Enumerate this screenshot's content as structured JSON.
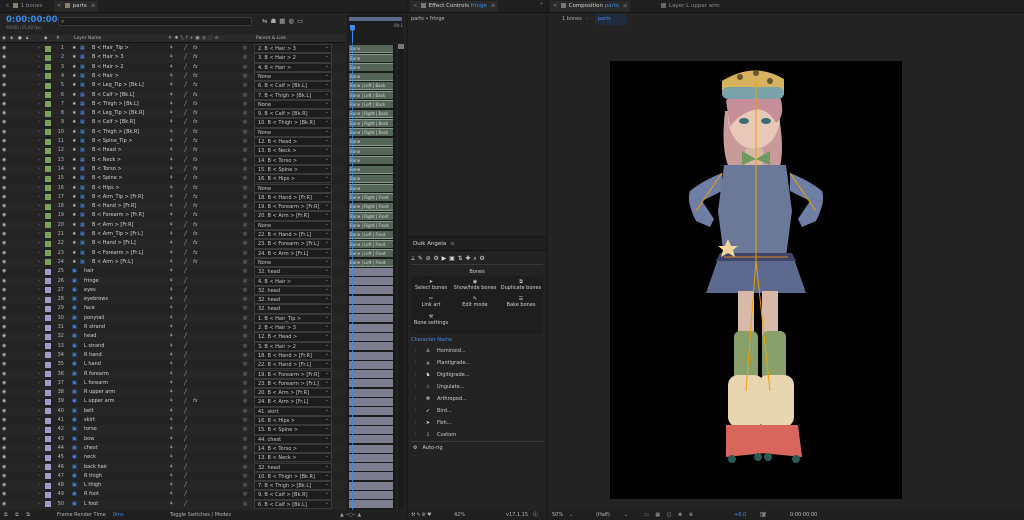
{
  "timeline": {
    "tabs": [
      {
        "label": "1 bones"
      },
      {
        "label": "parts"
      }
    ],
    "timecode": "0:00:00:00",
    "frame_info": "00000 (25.00 fps)",
    "search_placeholder": "",
    "col_layer_name": "Layer Name",
    "col_parent": "Parent & Link",
    "ruler_end": "00:1",
    "footer_render": "Frame Render Time",
    "footer_render_val": "0ms",
    "footer_toggle": "Toggle Switches / Modes",
    "layers": [
      {
        "n": "1",
        "name": "B < Hair_Tip >",
        "parent": "2. B < Hair > 3",
        "g": "b",
        "c": "#7ea05f",
        "bone": "Bone"
      },
      {
        "n": "2",
        "name": "B < Hair > 3",
        "parent": "3. B < Hair > 2",
        "g": "b",
        "c": "#7ea05f",
        "bone": "Bone"
      },
      {
        "n": "3",
        "name": "B < Hair > 2",
        "parent": "4. B < Hair >",
        "g": "b",
        "c": "#7ea05f",
        "bone": "Bone"
      },
      {
        "n": "4",
        "name": "B < Hair >",
        "parent": "None",
        "g": "b",
        "c": "#7ea05f",
        "bone": "Bone"
      },
      {
        "n": "5",
        "name": "B < Leg_Tip > [Bk.L]",
        "parent": "6. B < Calf > [Bk.L]",
        "g": "b",
        "c": "#7ea05f",
        "bone": "Bone | Left | Back"
      },
      {
        "n": "6",
        "name": "B < Calf > [Bk.L]",
        "parent": "7. B < Thigh > [Bk.L]",
        "g": "b",
        "c": "#7ea05f",
        "bone": "Bone | Left | Back"
      },
      {
        "n": "7",
        "name": "B < Thigh > [Bk.L]",
        "parent": "None",
        "g": "b",
        "c": "#7ea05f",
        "bone": "Bone | Left | Back"
      },
      {
        "n": "8",
        "name": "B < Leg_Tip > [Bk.R]",
        "parent": "9. B < Calf > [Bk.R]",
        "g": "b",
        "c": "#7ea05f",
        "bone": "Bone | Right | Back"
      },
      {
        "n": "9",
        "name": "B < Calf > [Bk.R]",
        "parent": "10. B < Thigh > [Bk.R]",
        "g": "b",
        "c": "#7ea05f",
        "bone": "Bone | Right | Back"
      },
      {
        "n": "10",
        "name": "B < Thigh > [Bk.R]",
        "parent": "None",
        "g": "b",
        "c": "#7ea05f",
        "bone": "Bone | Right | Back"
      },
      {
        "n": "11",
        "name": "B < Spine_Tip >",
        "parent": "12. B < Head >",
        "g": "b",
        "c": "#7ea05f",
        "bone": "Bone"
      },
      {
        "n": "12",
        "name": "B < Head >",
        "parent": "13. B < Neck >",
        "g": "b",
        "c": "#7ea05f",
        "bone": "Bone"
      },
      {
        "n": "13",
        "name": "B < Neck >",
        "parent": "14. B < Torso >",
        "g": "b",
        "c": "#7ea05f",
        "bone": "Bone"
      },
      {
        "n": "14",
        "name": "B < Torso >",
        "parent": "15. B < Spine >",
        "g": "b",
        "c": "#7ea05f",
        "bone": "Bone"
      },
      {
        "n": "15",
        "name": "B < Spine >",
        "parent": "16. B < Hips >",
        "g": "b",
        "c": "#7ea05f",
        "bone": "Bone"
      },
      {
        "n": "16",
        "name": "B < Hips >",
        "parent": "None",
        "g": "b",
        "c": "#7ea05f",
        "bone": "Bone"
      },
      {
        "n": "17",
        "name": "B < Arm_Tip > [Fr.R]",
        "parent": "18. B < Hand > [Fr.R]",
        "g": "b",
        "c": "#7ea05f",
        "bone": "Bone | Right | Front"
      },
      {
        "n": "18",
        "name": "B < Hand > [Fr.R]",
        "parent": "19. B < Forearm > [Fr.R]",
        "g": "b",
        "c": "#7ea05f",
        "bone": "Bone | Right | Front"
      },
      {
        "n": "19",
        "name": "B < Forearm > [Fr.R]",
        "parent": "20. B < Arm > [Fr.R]",
        "g": "b",
        "c": "#7ea05f",
        "bone": "Bone | Right | Front"
      },
      {
        "n": "20",
        "name": "B < Arm > [Fr.R]",
        "parent": "None",
        "g": "b",
        "c": "#7ea05f",
        "bone": "Bone | Right | Front"
      },
      {
        "n": "21",
        "name": "B < Arm_Tip > [Fr.L]",
        "parent": "22. B < Hand > [Fr.L]",
        "g": "b",
        "c": "#7ea05f",
        "bone": "Bone | Left | Front"
      },
      {
        "n": "22",
        "name": "B < Hand > [Fr.L]",
        "parent": "23. B < Forearm > [Fr.L]",
        "g": "b",
        "c": "#7ea05f",
        "bone": "Bone | Left | Front"
      },
      {
        "n": "23",
        "name": "B < Forearm > [Fr.L]",
        "parent": "24. B < Arm > [Fr.L]",
        "g": "b",
        "c": "#7ea05f",
        "bone": "Bone | Left | Front"
      },
      {
        "n": "24",
        "name": "B < Arm > [Fr.L]",
        "parent": "None",
        "g": "b",
        "c": "#7ea05f",
        "bone": "Bone | Left | Front"
      },
      {
        "n": "25",
        "name": "hair",
        "parent": "32. head",
        "g": "l",
        "c": "#a59ac7",
        "bone": ""
      },
      {
        "n": "26",
        "name": "fringe",
        "parent": "4. B < Hair >",
        "g": "l",
        "c": "#a59ac7",
        "bone": ""
      },
      {
        "n": "27",
        "name": "eyes",
        "parent": "32. head",
        "g": "l",
        "c": "#a59ac7",
        "bone": ""
      },
      {
        "n": "28",
        "name": "eyebrows",
        "parent": "32. head",
        "g": "l",
        "c": "#a59ac7",
        "bone": ""
      },
      {
        "n": "29",
        "name": "face",
        "parent": "32. head",
        "g": "l",
        "c": "#a59ac7",
        "bone": ""
      },
      {
        "n": "30",
        "name": "ponytail",
        "parent": "1. B < Hair_Tip >",
        "g": "l",
        "c": "#a59ac7",
        "bone": ""
      },
      {
        "n": "31",
        "name": "R strand",
        "parent": "2. B < Hair > 3",
        "g": "l",
        "c": "#a59ac7",
        "bone": ""
      },
      {
        "n": "32",
        "name": "head",
        "parent": "12. B < Head >",
        "g": "l",
        "c": "#a59ac7",
        "bone": ""
      },
      {
        "n": "33",
        "name": "L strand",
        "parent": "3. B < Hair > 2",
        "g": "l",
        "c": "#a59ac7",
        "bone": ""
      },
      {
        "n": "34",
        "name": "R hand",
        "parent": "18. B < Hand > [Fr.R]",
        "g": "l",
        "c": "#a59ac7",
        "bone": ""
      },
      {
        "n": "35",
        "name": "L hand",
        "parent": "22. B < Hand > [Fr.L]",
        "g": "l",
        "c": "#a59ac7",
        "bone": ""
      },
      {
        "n": "36",
        "name": "R forearm",
        "parent": "19. B < Forearm > [Fr.R]",
        "g": "l",
        "c": "#a59ac7",
        "bone": ""
      },
      {
        "n": "37",
        "name": "L forearm",
        "parent": "23. B < Forearm > [Fr.L]",
        "g": "l",
        "c": "#a59ac7",
        "bone": ""
      },
      {
        "n": "38",
        "name": "R upper arm",
        "parent": "20. B < Arm > [Fr.R]",
        "g": "l",
        "c": "#a59ac7",
        "bone": ""
      },
      {
        "n": "39",
        "name": "L upper arm",
        "parent": "24. B < Arm > [Fr.L]",
        "g": "l",
        "c": "#a59ac7",
        "bone": ""
      },
      {
        "n": "40",
        "name": "belt",
        "parent": "41. skirt",
        "g": "l",
        "c": "#a59ac7",
        "bone": ""
      },
      {
        "n": "41",
        "name": "skirt",
        "parent": "16. B < Hips >",
        "g": "l",
        "c": "#a59ac7",
        "bone": ""
      },
      {
        "n": "42",
        "name": "torso",
        "parent": "15. B < Spine >",
        "g": "l",
        "c": "#a59ac7",
        "bone": ""
      },
      {
        "n": "43",
        "name": "bow",
        "parent": "44. chest",
        "g": "l",
        "c": "#a59ac7",
        "bone": ""
      },
      {
        "n": "44",
        "name": "chest",
        "parent": "14. B < Torso >",
        "g": "l",
        "c": "#a59ac7",
        "bone": ""
      },
      {
        "n": "45",
        "name": "neck",
        "parent": "13. B < Neck >",
        "g": "l",
        "c": "#a59ac7",
        "bone": ""
      },
      {
        "n": "46",
        "name": "back hair",
        "parent": "32. head",
        "g": "l",
        "c": "#a59ac7",
        "bone": ""
      },
      {
        "n": "47",
        "name": "R thigh",
        "parent": "10. B < Thigh > [Bk.R]",
        "g": "l",
        "c": "#a59ac7",
        "bone": ""
      },
      {
        "n": "48",
        "name": "L thigh",
        "parent": "7. B < Thigh > [Bk.L]",
        "g": "l",
        "c": "#a59ac7",
        "bone": ""
      },
      {
        "n": "49",
        "name": "R foot",
        "parent": "9. B < Calf > [Bk.R]",
        "g": "l",
        "c": "#a59ac7",
        "bone": ""
      },
      {
        "n": "50",
        "name": "L foot",
        "parent": "6. B < Calf > [Bk.L]",
        "g": "l",
        "c": "#a59ac7",
        "bone": ""
      }
    ]
  },
  "effect_controls": {
    "tab_label": "Effect Controls",
    "tab_target": "fringe",
    "breadcrumb": "parts • fringe"
  },
  "duik": {
    "title": "Duik Angela",
    "section_bones": "Bones",
    "buttons": [
      {
        "label": "Select bones",
        "icon": "cursor"
      },
      {
        "label": "Show/hide bones",
        "icon": "eye"
      },
      {
        "label": "Duplicate bones",
        "icon": "copy"
      },
      {
        "label": "Link art",
        "icon": "link"
      },
      {
        "label": "Edit mode",
        "icon": "pencil"
      },
      {
        "label": "Bake bones",
        "icon": "stack"
      }
    ],
    "bone_settings": "Bone settings",
    "character_name": "Character Name",
    "characters": [
      "Hominoid...",
      "Plantigrade...",
      "Digitigrade...",
      "Ungulate...",
      "Arthropod...",
      "Bird...",
      "Fish...",
      "Custom"
    ],
    "auto_rig": "Auto-rig",
    "zoom": "42%",
    "version": "v17.1.15"
  },
  "composition": {
    "tab_label": "Composition",
    "tab_target": "parts",
    "layer_tab": "Layer  L upper arm",
    "nav_prev": "1 bones",
    "nav_cur": "parts",
    "zoom": "50%",
    "resolution": "(Half)",
    "exposure": "+0.0",
    "timecode": "0:00:00:00"
  }
}
